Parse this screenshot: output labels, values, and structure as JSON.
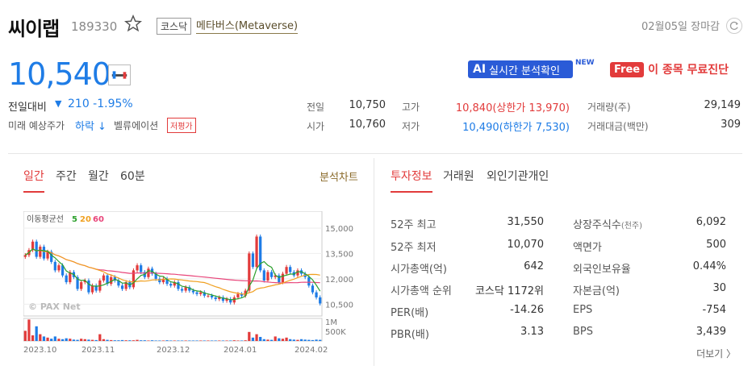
{
  "header": {
    "stock_name": "씨이랩",
    "stock_code": "189330",
    "market": "코스닥",
    "theme": "메타버스(Metaverse)",
    "date_status": "02월05일 장마감"
  },
  "price": {
    "current": "10,540",
    "change_label": "전일대비",
    "change_arrow": "▼",
    "change_value": "210 -1.95%",
    "forecast_label": "미래 예상주가",
    "forecast_value": "하락 ↓",
    "valuation_label": "벨류에이션",
    "valuation_badge": "저평가"
  },
  "promo": {
    "ai_prefix": "AI",
    "ai_label": "실시간 분석확인",
    "new_badge": "NEW",
    "free_badge": "Free",
    "free_label": "이 종목 무료진단"
  },
  "quote": {
    "prev_close_label": "전일",
    "prev_close": "10,750",
    "open_label": "시가",
    "open": "10,760",
    "high_label": "고가",
    "high": "10,840(상한가 13,970)",
    "low_label": "저가",
    "low": "10,490(하한가 7,530)",
    "volume_label": "거래량(주)",
    "volume": "29,149",
    "amount_label": "거래대금(백만)",
    "amount": "309"
  },
  "chart_tabs": [
    "일간",
    "주간",
    "월간",
    "60분"
  ],
  "chart_link": "분석차트",
  "info_tabs": [
    "투자정보",
    "거래원",
    "외인기관개인"
  ],
  "info": {
    "left": [
      {
        "label": "52주 최고",
        "value": "31,550"
      },
      {
        "label": "52주 최저",
        "value": "10,070"
      },
      {
        "label": "시가총액(억)",
        "value": "642"
      },
      {
        "label": "시가총액 순위",
        "value": "코스닥 1172위"
      },
      {
        "label": "PER(배)",
        "value": "-14.26"
      },
      {
        "label": "PBR(배)",
        "value": "3.13"
      }
    ],
    "right": [
      {
        "label": "상장주식수",
        "label_sub": "(천주)",
        "value": "6,092"
      },
      {
        "label": "액면가",
        "label_sub": "",
        "value": "500"
      },
      {
        "label": "외국인보유율",
        "label_sub": "",
        "value": "0.44%"
      },
      {
        "label": "자본금(억)",
        "label_sub": "",
        "value": "30"
      },
      {
        "label": "EPS",
        "label_sub": "",
        "value": "-754"
      },
      {
        "label": "BPS",
        "label_sub": "",
        "value": "3,439"
      }
    ],
    "more": "더보기 〉"
  },
  "chart_data": {
    "type": "line",
    "title": "",
    "legend_prefix": "이동평균선",
    "ma_labels": [
      "5",
      "20",
      "60"
    ],
    "ma_colors": [
      "#2ca02c",
      "#f0a020",
      "#e8457a"
    ],
    "watermark": "© PAX Net",
    "y_ticks": [
      "15,000",
      "13,500",
      "12,000",
      "10,500"
    ],
    "y_values": [
      15000,
      13500,
      12000,
      10500
    ],
    "ylim": [
      9800,
      16000
    ],
    "vol_ticks": [
      "1M",
      "500K"
    ],
    "x_labels": [
      "2023.10",
      "2023.11",
      "2023.12",
      "2024.01",
      "2024.02"
    ],
    "close": [
      13400,
      13700,
      14200,
      13300,
      13900,
      13200,
      13600,
      13000,
      12500,
      12800,
      12200,
      11800,
      12400,
      12100,
      11400,
      11800,
      11900,
      11200,
      11600,
      11300,
      11900,
      12200,
      11700,
      12100,
      11900,
      11600,
      11400,
      11800,
      11500,
      12500,
      12800,
      12400,
      12100,
      12600,
      12300,
      12000,
      11800,
      12000,
      11700,
      11600,
      11800,
      11400,
      11300,
      11500,
      11300,
      11200,
      11100,
      11200,
      11000,
      11000,
      10900,
      10800,
      10900,
      10700,
      10800,
      10600,
      10900,
      11100,
      11000,
      11300,
      13500,
      12700,
      14500,
      12500,
      11900,
      12400,
      12100,
      12200,
      11800,
      12300,
      12700,
      12400,
      12200,
      12500,
      12300,
      12100,
      11600,
      11200,
      10900,
      10540
    ],
    "volume": [
      0.45,
      0.95,
      0.25,
      0.65,
      0.3,
      0.2,
      0.15,
      0.1,
      0.2,
      0.1,
      0.08,
      0.12,
      0.1,
      0.06,
      0.05,
      0.1,
      0.08,
      0.06,
      0.05,
      0.04,
      0.3,
      0.08,
      0.05,
      0.04,
      0.03,
      0.03,
      0.04,
      0.03,
      0.03,
      0.03,
      0.05,
      0.03,
      0.03,
      0.02,
      0.03,
      0.02,
      0.02,
      0.02,
      0.03,
      0.02,
      0.02,
      0.02,
      0.02,
      0.02,
      0.02,
      0.02,
      0.02,
      0.02,
      0.02,
      0.02,
      0.02,
      0.02,
      0.02,
      0.02,
      0.02,
      0.02,
      0.03,
      0.02,
      0.02,
      0.03,
      0.4,
      0.15,
      0.3,
      0.18,
      0.08,
      0.06,
      0.05,
      0.2,
      0.12,
      0.1,
      0.15,
      0.08,
      0.06,
      0.05,
      0.08,
      0.06,
      0.05,
      0.04,
      0.06,
      0.05
    ]
  }
}
